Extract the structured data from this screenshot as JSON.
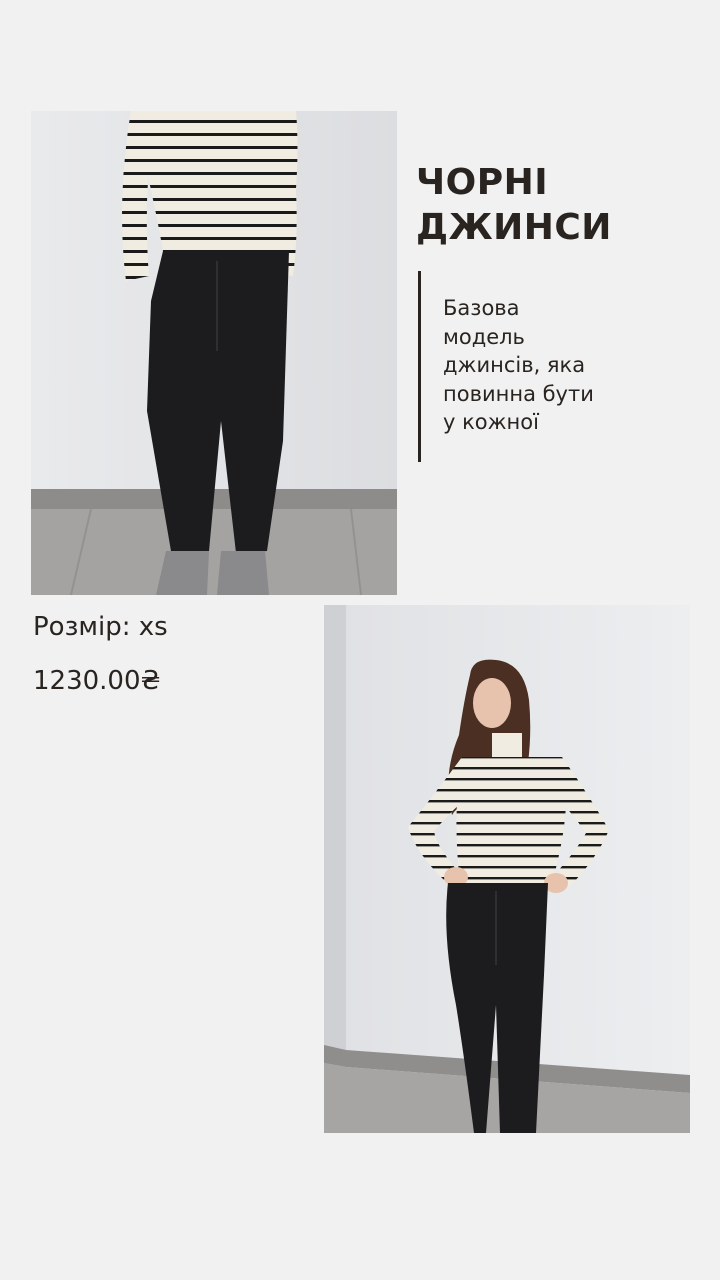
{
  "product": {
    "title_line1": "ЧОРНІ",
    "title_line2": "ДЖИНСИ",
    "description_lines": [
      "Базова",
      "модель",
      "джинсів, яка",
      "повинна бути",
      "у кожної"
    ],
    "size_label": "Розмір: xs",
    "price": "1230.00₴"
  },
  "colors": {
    "background": "#f1f1f1",
    "text": "#2a2421",
    "wall": "#e6e7e9",
    "floor": "#a4a3a2",
    "denim": "#1c1c1f",
    "sweater": "#f0ece2",
    "stripe": "#1a1a1a",
    "hair": "#4a2f22"
  }
}
